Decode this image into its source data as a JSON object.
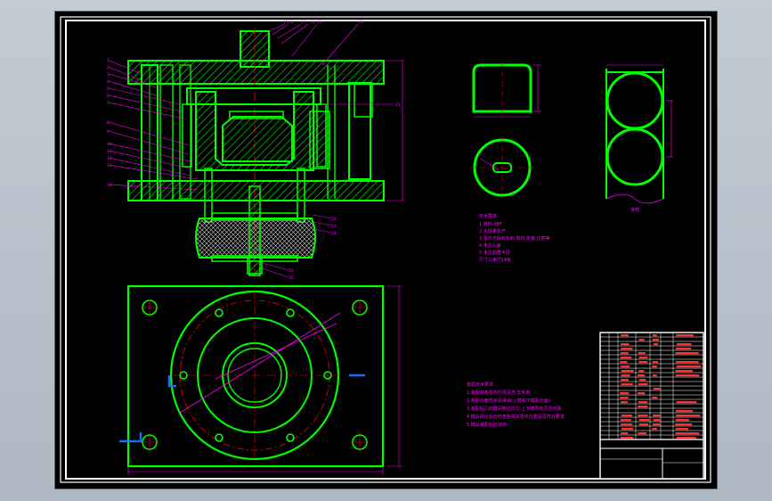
{
  "viewer": {
    "background_color": "#b8c1cb",
    "canvas_color": "#000000"
  },
  "colors": {
    "outline": "#ffffff",
    "part": "#00ff00",
    "dimension": "#ff00ff",
    "centerline": "#ff0000",
    "title_block_text": "#ff3030",
    "annotation": "#ff00ff",
    "blue_mark": "#1a6cff"
  },
  "views": {
    "section_view": "assembly section of die",
    "plan_view": "top view of lower die",
    "part_views": [
      "cup side view",
      "cup top view",
      "blank layout strip"
    ]
  },
  "notes": {
    "technical_requirements": {
      "heading": "技术要求",
      "items": [
        "1.材料:08F",
        "2.大批量生产",
        "3.零件不得有毛刺,裂纹,折皱,拉痕等",
        "4.未注公差",
        "5.未注圆角半径",
        "尺寸公差IT14级"
      ]
    },
    "assembly_requirements": {
      "heading": "装配技术要求",
      "items": [
        "1.装配前各零件均须清洗,去毛刺.",
        "2.各配合面应涂润滑油(上模和下模配合面).",
        "3.装配后凸凹模间隙应均匀,上下模导向灵活可靠.",
        "4.模具闭合后应检查各相关零件位置是否符合要求.",
        "5.模具装配后应试冲."
      ]
    },
    "strip_label": "排样"
  }
}
